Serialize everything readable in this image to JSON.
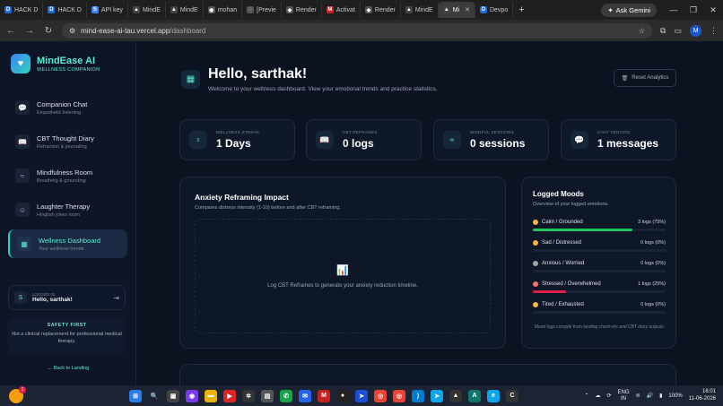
{
  "browser": {
    "tabs": [
      {
        "label": "HACK D",
        "color": "#1e6ad6",
        "glyph": "D"
      },
      {
        "label": "HACK D",
        "color": "#1e6ad6",
        "glyph": "D"
      },
      {
        "label": "API key",
        "color": "#3b82f6",
        "glyph": "S"
      },
      {
        "label": "MindE",
        "color": "#444",
        "glyph": "▲"
      },
      {
        "label": "MindE",
        "color": "#444",
        "glyph": "▲"
      },
      {
        "label": "mohan",
        "color": "#555",
        "glyph": "◉"
      },
      {
        "label": "[Previe",
        "color": "#555",
        "glyph": "◌"
      },
      {
        "label": "Render",
        "color": "#555",
        "glyph": "◆"
      },
      {
        "label": "Activat",
        "color": "#c5221f",
        "glyph": "M"
      },
      {
        "label": "Render",
        "color": "#555",
        "glyph": "◆"
      },
      {
        "label": "MindE",
        "color": "#444",
        "glyph": "▲"
      },
      {
        "label": "Mi",
        "color": "#444",
        "glyph": "▲",
        "active": true
      },
      {
        "label": "Devpo",
        "color": "#1e6ad6",
        "glyph": "D"
      }
    ],
    "new_tab": "+",
    "ask_gemini": "Ask Gemini",
    "url_host": "mind-ease-ai-tau.vercel.app",
    "url_path": "/dashboard",
    "profile_initial": "M"
  },
  "sidebar": {
    "brand_title": "MindEase AI",
    "brand_subtitle": "WELLNESS COMPANION",
    "items": [
      {
        "label": "Companion Chat",
        "sub": "Empathetic listening",
        "icon": "💬"
      },
      {
        "label": "CBT Thought Diary",
        "sub": "Refraction & journaling",
        "icon": "📖"
      },
      {
        "label": "Mindfulness Room",
        "sub": "Breathing & grounding",
        "icon": "≈"
      },
      {
        "label": "Laughter Therapy",
        "sub": "Hinglish jokes room",
        "icon": "☺"
      },
      {
        "label": "Wellness Dashboard",
        "sub": "Your wellness trends",
        "icon": "▦"
      }
    ],
    "user_avatar": "S",
    "logged_in_label": "LOGGED IN",
    "user_greeting": "Hello, sarthak!",
    "safety_title": "SAFETY FIRST",
    "safety_text": "Not a clinical replacement for professional medical therapy.",
    "back_link": "← Back to Landing"
  },
  "main": {
    "title": "Hello, sarthak!",
    "subtitle": "Welcome to your wellness dashboard. View your emotional trends and practice statistics.",
    "reset_button": "Reset Analytics",
    "stats": [
      {
        "label": "WELLNESS STREAK",
        "value": "1 Days",
        "icon": "♀"
      },
      {
        "label": "CBT REFRAMES",
        "value": "0 logs",
        "icon": "📖"
      },
      {
        "label": "MINDFUL SESSIONS",
        "value": "0 sessions",
        "icon": "≈"
      },
      {
        "label": "CHAT VENTING",
        "value": "1 messages",
        "icon": "💬"
      }
    ],
    "anxiety": {
      "title": "Anxiety Reframing Impact",
      "subtitle": "Compares distress intensity (1-10) before and after CBT reframing.",
      "empty_text": "Log CBT Reframes to generate your anxiety reduction timeline."
    },
    "moods": {
      "title": "Logged Moods",
      "subtitle": "Overview of your logged emotions.",
      "items": [
        {
          "name": "Calm / Grounded",
          "count": "3 logs (75%)",
          "pct": 75,
          "color": "#22c55e",
          "dot": "#f5b83d"
        },
        {
          "name": "Sad / Distressed",
          "count": "0 logs (0%)",
          "pct": 0,
          "color": "#3b82f6",
          "dot": "#f5b83d"
        },
        {
          "name": "Anxious / Worried",
          "count": "0 logs (0%)",
          "pct": 0,
          "color": "#a855f7",
          "dot": "#a3a3a3"
        },
        {
          "name": "Stressed / Overwhelmed",
          "count": "1 logs (25%)",
          "pct": 25,
          "color": "#e11d48",
          "dot": "#f87171"
        },
        {
          "name": "Tired / Exhausted",
          "count": "0 logs (0%)",
          "pct": 0,
          "color": "#f59e0b",
          "dot": "#f5b83d"
        }
      ],
      "footnote": "Mood logs compile from landing check-ins and CBT diary outputs."
    }
  },
  "taskbar": {
    "weather_badge": "1",
    "lang": "ENG",
    "region": "IN",
    "battery": "100%",
    "time": "16:01",
    "date": "11-06-2026"
  }
}
